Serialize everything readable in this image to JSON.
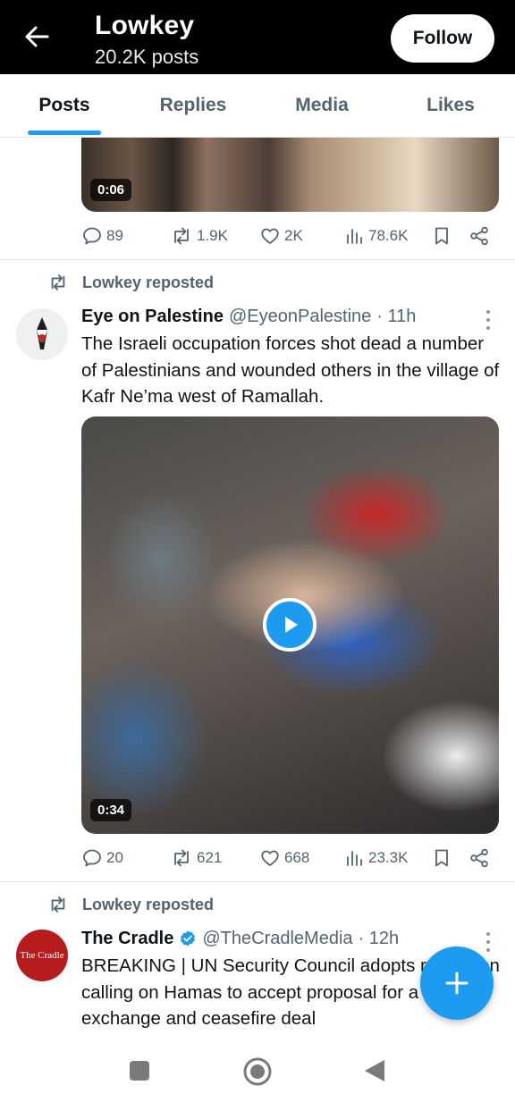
{
  "header": {
    "name": "Lowkey",
    "post_count": "20.2K posts",
    "follow_label": "Follow"
  },
  "tabs": [
    {
      "label": "Posts",
      "active": true
    },
    {
      "label": "Replies",
      "active": false
    },
    {
      "label": "Media",
      "active": false
    },
    {
      "label": "Likes",
      "active": false
    }
  ],
  "post0": {
    "video_duration": "0:06",
    "replies": "89",
    "reposts": "1.9K",
    "likes": "2K",
    "views": "78.6K"
  },
  "post1": {
    "repost_text": "Lowkey reposted",
    "author": "Eye on Palestine",
    "handle": "@EyeonPalestine",
    "time": "· 11h",
    "text": "The Israeli occupation forces shot dead a number of Palestinians and wounded others in the village of Kafr Ne’ma west of Ramallah.",
    "video_duration": "0:34",
    "replies": "20",
    "reposts": "621",
    "likes": "668",
    "views": "23.3K"
  },
  "post2": {
    "repost_text": "Lowkey reposted",
    "author": "The Cradle",
    "handle": "@TheCradleMedia",
    "time": "· 12h",
    "avatar_text": "The Cradle",
    "text": "BREAKING | UN Security Council adopts resolution calling on Hamas to accept proposal for a prisoner exchange and ceasefire deal"
  },
  "colors": {
    "accent": "#1d9bf0",
    "header_bg": "#000000",
    "secondary_text": "#536471"
  },
  "icons": {
    "back": "arrow-left-icon",
    "reply": "speech-bubble-icon",
    "repost": "repost-arrows-icon",
    "like": "heart-icon",
    "views": "bar-chart-icon",
    "bookmark": "bookmark-icon",
    "share": "share-icon",
    "more": "more-vertical-icon",
    "compose": "plus-icon",
    "nav_recents": "square-icon",
    "nav_home": "circle-icon",
    "nav_back": "triangle-back-icon"
  }
}
